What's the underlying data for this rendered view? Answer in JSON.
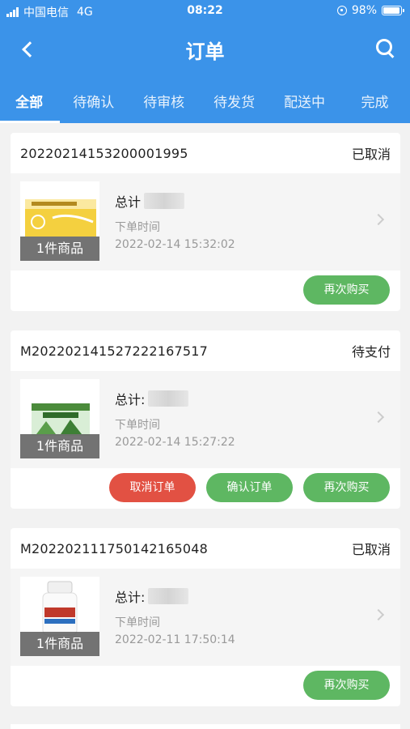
{
  "status_bar": {
    "carrier": "中国电信",
    "network": "4G",
    "time": "08:22",
    "battery_text": "98%",
    "battery_level": 0.98
  },
  "nav": {
    "title": "订单",
    "back_icon": "chevron-left-icon",
    "search_icon": "search-icon"
  },
  "tabs": [
    {
      "label": "全部",
      "active": true
    },
    {
      "label": "待确认",
      "active": false
    },
    {
      "label": "待审核",
      "active": false
    },
    {
      "label": "待发货",
      "active": false
    },
    {
      "label": "配送中",
      "active": false
    },
    {
      "label": "完成",
      "active": false
    }
  ],
  "orders": [
    {
      "order_no": "20220214153200001995",
      "status": "已取消",
      "thumb_label": "1件商品",
      "total_label": "总计",
      "time_label": "下单时间",
      "time": "2022-02-14 15:32:02",
      "actions": [
        "再次购买"
      ]
    },
    {
      "order_no": "M20220214152722216751​7",
      "status": "待支付",
      "thumb_label": "1件商品",
      "total_label": "总计:",
      "time_label": "下单时间",
      "time": "2022-02-14 15:27:22",
      "actions": [
        "取消订单",
        "确认订单",
        "再次购买"
      ]
    },
    {
      "order_no": "M20220211175014216504​8",
      "status": "已取消",
      "thumb_label": "1件商品",
      "total_label": "总计:",
      "time_label": "下单时间",
      "time": "2022-02-11 17:50:14",
      "actions": [
        "再次购买"
      ]
    }
  ],
  "colors": {
    "header": "#3b93e9",
    "green_button": "#5eb762",
    "red_button": "#e25143"
  }
}
